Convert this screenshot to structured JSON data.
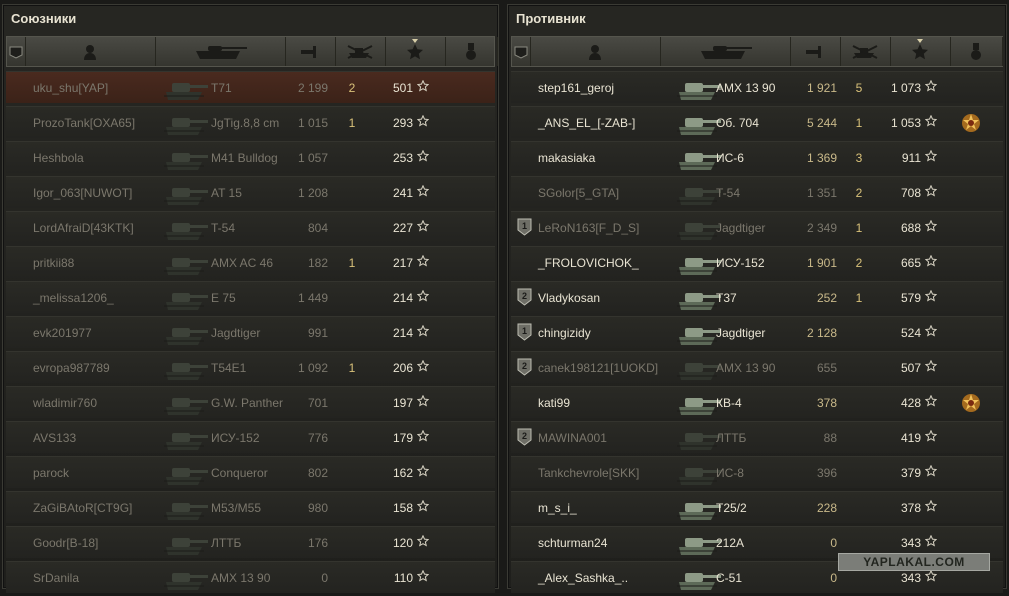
{
  "allies": {
    "title": "Союзники",
    "players": [
      {
        "name": "uku_shu[YAP]",
        "tank": "T71",
        "damage": "2 199",
        "kills": "2",
        "xp": "501",
        "self": true,
        "dead": true,
        "badge": "",
        "medal": false
      },
      {
        "name": "ProzoTank[OXA65]",
        "tank": "JgTig.8,8 cm",
        "damage": "1 015",
        "kills": "1",
        "xp": "293",
        "self": false,
        "dead": true,
        "badge": "",
        "medal": false
      },
      {
        "name": "Heshbola",
        "tank": "M41 Bulldog",
        "damage": "1 057",
        "kills": "",
        "xp": "253",
        "self": false,
        "dead": true,
        "badge": "",
        "medal": false
      },
      {
        "name": "Igor_063[NUWOT]",
        "tank": "AT 15",
        "damage": "1 208",
        "kills": "",
        "xp": "241",
        "self": false,
        "dead": true,
        "badge": "",
        "medal": false
      },
      {
        "name": "LordAfraiD[43KTK]",
        "tank": "T-54",
        "damage": "804",
        "kills": "",
        "xp": "227",
        "self": false,
        "dead": true,
        "badge": "",
        "medal": false
      },
      {
        "name": "pritkii88",
        "tank": "AMX AC 46",
        "damage": "182",
        "kills": "1",
        "xp": "217",
        "self": false,
        "dead": true,
        "badge": "",
        "medal": false
      },
      {
        "name": "_melissa1206_",
        "tank": "E 75",
        "damage": "1 449",
        "kills": "",
        "xp": "214",
        "self": false,
        "dead": true,
        "badge": "",
        "medal": false
      },
      {
        "name": "evk201977",
        "tank": "Jagdtiger",
        "damage": "991",
        "kills": "",
        "xp": "214",
        "self": false,
        "dead": true,
        "badge": "",
        "medal": false
      },
      {
        "name": "evropa987789",
        "tank": "T54E1",
        "damage": "1 092",
        "kills": "1",
        "xp": "206",
        "self": false,
        "dead": true,
        "badge": "",
        "medal": false
      },
      {
        "name": "wladimir760",
        "tank": "G.W. Panther",
        "damage": "701",
        "kills": "",
        "xp": "197",
        "self": false,
        "dead": true,
        "badge": "",
        "medal": false
      },
      {
        "name": "AVS133",
        "tank": "ИСУ-152",
        "damage": "776",
        "kills": "",
        "xp": "179",
        "self": false,
        "dead": true,
        "badge": "",
        "medal": false
      },
      {
        "name": "parock",
        "tank": "Conqueror",
        "damage": "802",
        "kills": "",
        "xp": "162",
        "self": false,
        "dead": true,
        "badge": "",
        "medal": false
      },
      {
        "name": "ZaGiBAtoR[CT9G]",
        "tank": "M53/M55",
        "damage": "980",
        "kills": "",
        "xp": "158",
        "self": false,
        "dead": true,
        "badge": "",
        "medal": false
      },
      {
        "name": "Goodr[B-18]",
        "tank": "ЛТТБ",
        "damage": "176",
        "kills": "",
        "xp": "120",
        "self": false,
        "dead": true,
        "badge": "",
        "medal": false
      },
      {
        "name": "SrDanila",
        "tank": "AMX 13 90",
        "damage": "0",
        "kills": "",
        "xp": "110",
        "self": false,
        "dead": true,
        "badge": "",
        "medal": false
      }
    ]
  },
  "enemies": {
    "title": "Противник",
    "players": [
      {
        "name": "step161_geroj",
        "tank": "AMX 13 90",
        "damage": "1 921",
        "kills": "5",
        "xp": "1 073",
        "self": false,
        "dead": false,
        "badge": "",
        "medal": false
      },
      {
        "name": "_ANS_EL_[-ZAB-]",
        "tank": "Об. 704",
        "damage": "5 244",
        "kills": "1",
        "xp": "1 053",
        "self": false,
        "dead": false,
        "badge": "",
        "medal": true
      },
      {
        "name": "makasiaka",
        "tank": "ИС-6",
        "damage": "1 369",
        "kills": "3",
        "xp": "911",
        "self": false,
        "dead": false,
        "badge": "",
        "medal": false
      },
      {
        "name": "SGolor[5_GTA]",
        "tank": "T-54",
        "damage": "1 351",
        "kills": "2",
        "xp": "708",
        "self": false,
        "dead": true,
        "badge": "",
        "medal": false
      },
      {
        "name": "LeRoN163[F_D_S]",
        "tank": "Jagdtiger",
        "damage": "2 349",
        "kills": "1",
        "xp": "688",
        "self": false,
        "dead": true,
        "badge": "1",
        "medal": false
      },
      {
        "name": "_FROLOVICHOK_",
        "tank": "ИСУ-152",
        "damage": "1 901",
        "kills": "2",
        "xp": "665",
        "self": false,
        "dead": false,
        "badge": "",
        "medal": false
      },
      {
        "name": "Vladykosan",
        "tank": "T37",
        "damage": "252",
        "kills": "1",
        "xp": "579",
        "self": false,
        "dead": false,
        "badge": "2",
        "medal": false
      },
      {
        "name": "chingizidy",
        "tank": "Jagdtiger",
        "damage": "2 128",
        "kills": "",
        "xp": "524",
        "self": false,
        "dead": false,
        "badge": "1",
        "medal": false
      },
      {
        "name": "canek198121[1UOKD]",
        "tank": "AMX 13 90",
        "damage": "655",
        "kills": "",
        "xp": "507",
        "self": false,
        "dead": true,
        "badge": "2",
        "medal": false
      },
      {
        "name": "kati99",
        "tank": "КВ-4",
        "damage": "378",
        "kills": "",
        "xp": "428",
        "self": false,
        "dead": false,
        "badge": "",
        "medal": true
      },
      {
        "name": "MAWINA001",
        "tank": "ЛТТБ",
        "damage": "88",
        "kills": "",
        "xp": "419",
        "self": false,
        "dead": true,
        "badge": "2",
        "medal": false
      },
      {
        "name": "Tankchevrole[SKK]",
        "tank": "ИС-8",
        "damage": "396",
        "kills": "",
        "xp": "379",
        "self": false,
        "dead": true,
        "badge": "",
        "medal": false
      },
      {
        "name": "m_s_i_",
        "tank": "T25/2",
        "damage": "228",
        "kills": "",
        "xp": "378",
        "self": false,
        "dead": false,
        "badge": "",
        "medal": false
      },
      {
        "name": "schturman24",
        "tank": "212A",
        "damage": "0",
        "kills": "",
        "xp": "343",
        "self": false,
        "dead": false,
        "badge": "",
        "medal": false
      },
      {
        "name": "_Alex_Sashka_..",
        "tank": "C-51",
        "damage": "0",
        "kills": "",
        "xp": "343",
        "self": false,
        "dead": false,
        "badge": "",
        "medal": false
      }
    ]
  },
  "columns": [
    "badge-icon",
    "player-icon",
    "tank-icon",
    "damage-icon",
    "kills-icon",
    "xp-star-icon",
    "medal-icon"
  ],
  "watermark": "YAPLAKAL.COM",
  "colors": {
    "self_row": "#4a2a1f",
    "damage": "#c9b98a",
    "kills": "#d9c27a"
  }
}
